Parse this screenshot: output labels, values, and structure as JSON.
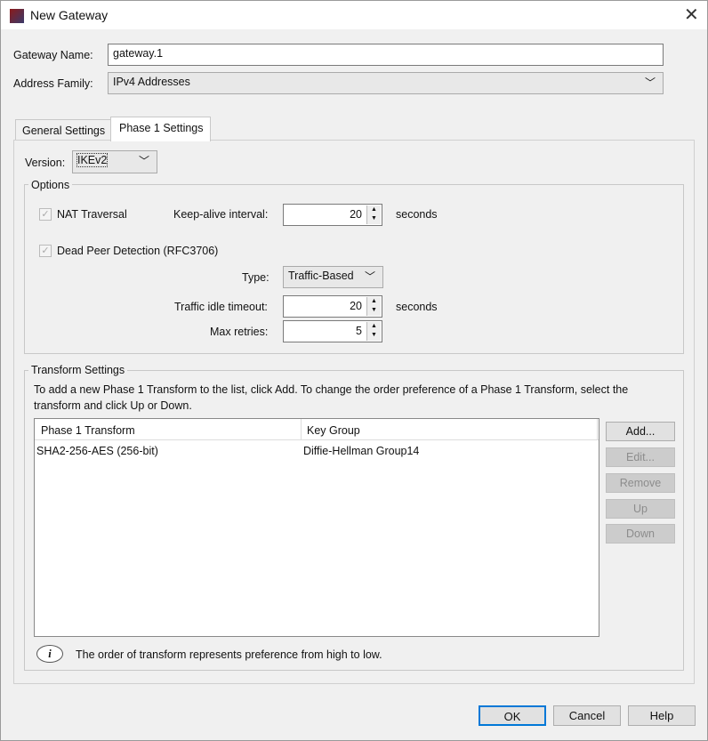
{
  "window": {
    "title": "New Gateway",
    "close_icon": "close-icon"
  },
  "form": {
    "gateway_name_label": "Gateway Name:",
    "gateway_name_value": "gateway.1",
    "address_family_label": "Address Family:",
    "address_family_value": "IPv4 Addresses"
  },
  "tabs": [
    {
      "label": "General Settings",
      "active": false
    },
    {
      "label": "Phase 1 Settings",
      "active": true
    }
  ],
  "phase1": {
    "version_label": "Version:",
    "version_value": "IKEv2",
    "options_title": "Options",
    "nat_traversal_label": "NAT Traversal",
    "nat_traversal_checked": true,
    "keepalive_label": "Keep-alive interval:",
    "keepalive_value": "20",
    "keepalive_unit": "seconds",
    "dpd_label": "Dead Peer Detection (RFC3706)",
    "dpd_checked": true,
    "type_label": "Type:",
    "type_value": "Traffic-Based",
    "idle_label": "Traffic idle timeout:",
    "idle_value": "20",
    "idle_unit": "seconds",
    "retries_label": "Max retries:",
    "retries_value": "5"
  },
  "transform": {
    "title": "Transform Settings",
    "instructions": "To add a new Phase 1 Transform to the list, click Add. To change the order preference of a Phase 1 Transform, select the transform and click Up or Down.",
    "columns": [
      "Phase 1 Transform",
      "Key Group"
    ],
    "rows": [
      [
        "SHA2-256-AES (256-bit)",
        "Diffie-Hellman Group14"
      ]
    ],
    "buttons": {
      "add": "Add...",
      "edit": "Edit...",
      "remove": "Remove",
      "up": "Up",
      "down": "Down"
    },
    "note": "The order of transform represents preference from high to low."
  },
  "footer": {
    "ok": "OK",
    "cancel": "Cancel",
    "help": "Help"
  }
}
